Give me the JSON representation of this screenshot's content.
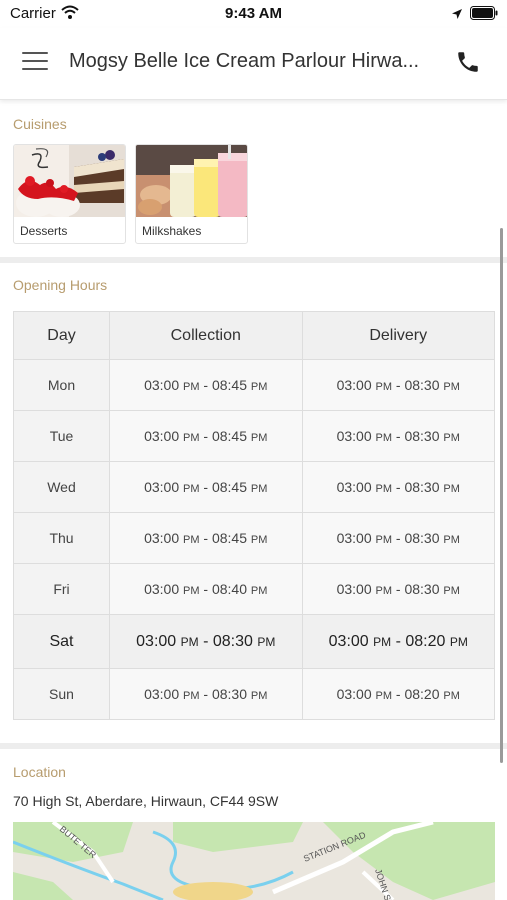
{
  "status_bar": {
    "carrier": "Carrier",
    "time": "9:43 AM"
  },
  "header": {
    "title": "Mogsy Belle Ice Cream Parlour Hirwa..."
  },
  "cuisines": {
    "label": "Cuisines",
    "items": [
      {
        "name": "Desserts"
      },
      {
        "name": "Milkshakes"
      }
    ]
  },
  "opening_hours": {
    "label": "Opening Hours",
    "columns": [
      "Day",
      "Collection",
      "Delivery"
    ],
    "rows": [
      {
        "day": "Mon",
        "collection": {
          "open": "03:00",
          "open_ampm": "PM",
          "close": "08:45",
          "close_ampm": "PM"
        },
        "delivery": {
          "open": "03:00",
          "open_ampm": "PM",
          "close": "08:30",
          "close_ampm": "PM"
        }
      },
      {
        "day": "Tue",
        "collection": {
          "open": "03:00",
          "open_ampm": "PM",
          "close": "08:45",
          "close_ampm": "PM"
        },
        "delivery": {
          "open": "03:00",
          "open_ampm": "PM",
          "close": "08:30",
          "close_ampm": "PM"
        }
      },
      {
        "day": "Wed",
        "collection": {
          "open": "03:00",
          "open_ampm": "PM",
          "close": "08:45",
          "close_ampm": "PM"
        },
        "delivery": {
          "open": "03:00",
          "open_ampm": "PM",
          "close": "08:30",
          "close_ampm": "PM"
        }
      },
      {
        "day": "Thu",
        "collection": {
          "open": "03:00",
          "open_ampm": "PM",
          "close": "08:45",
          "close_ampm": "PM"
        },
        "delivery": {
          "open": "03:00",
          "open_ampm": "PM",
          "close": "08:30",
          "close_ampm": "PM"
        }
      },
      {
        "day": "Fri",
        "collection": {
          "open": "03:00",
          "open_ampm": "PM",
          "close": "08:40",
          "close_ampm": "PM"
        },
        "delivery": {
          "open": "03:00",
          "open_ampm": "PM",
          "close": "08:30",
          "close_ampm": "PM"
        }
      },
      {
        "day": "Sat",
        "collection": {
          "open": "03:00",
          "open_ampm": "PM",
          "close": "08:30",
          "close_ampm": "PM"
        },
        "delivery": {
          "open": "03:00",
          "open_ampm": "PM",
          "close": "08:20",
          "close_ampm": "PM"
        }
      },
      {
        "day": "Sun",
        "collection": {
          "open": "03:00",
          "open_ampm": "PM",
          "close": "08:30",
          "close_ampm": "PM"
        },
        "delivery": {
          "open": "03:00",
          "open_ampm": "PM",
          "close": "08:20",
          "close_ampm": "PM"
        }
      }
    ]
  },
  "location": {
    "label": "Location",
    "address": "70 High St, Aberdare, Hirwaun, CF44 9SW",
    "map_labels": {
      "street_1": "BUTE TER",
      "street_2": "STATION ROAD",
      "street_3": "JOHN ST"
    }
  },
  "colors": {
    "section_label": "#b79c6e",
    "section_divider": "#ededed",
    "map_road_water": "#7ad0ee",
    "map_green": "#c6e6b0"
  },
  "icons": {
    "menu": "hamburger-menu-icon",
    "phone": "phone-icon",
    "wifi": "wifi-icon",
    "location": "location-arrow-icon",
    "battery": "battery-icon"
  }
}
